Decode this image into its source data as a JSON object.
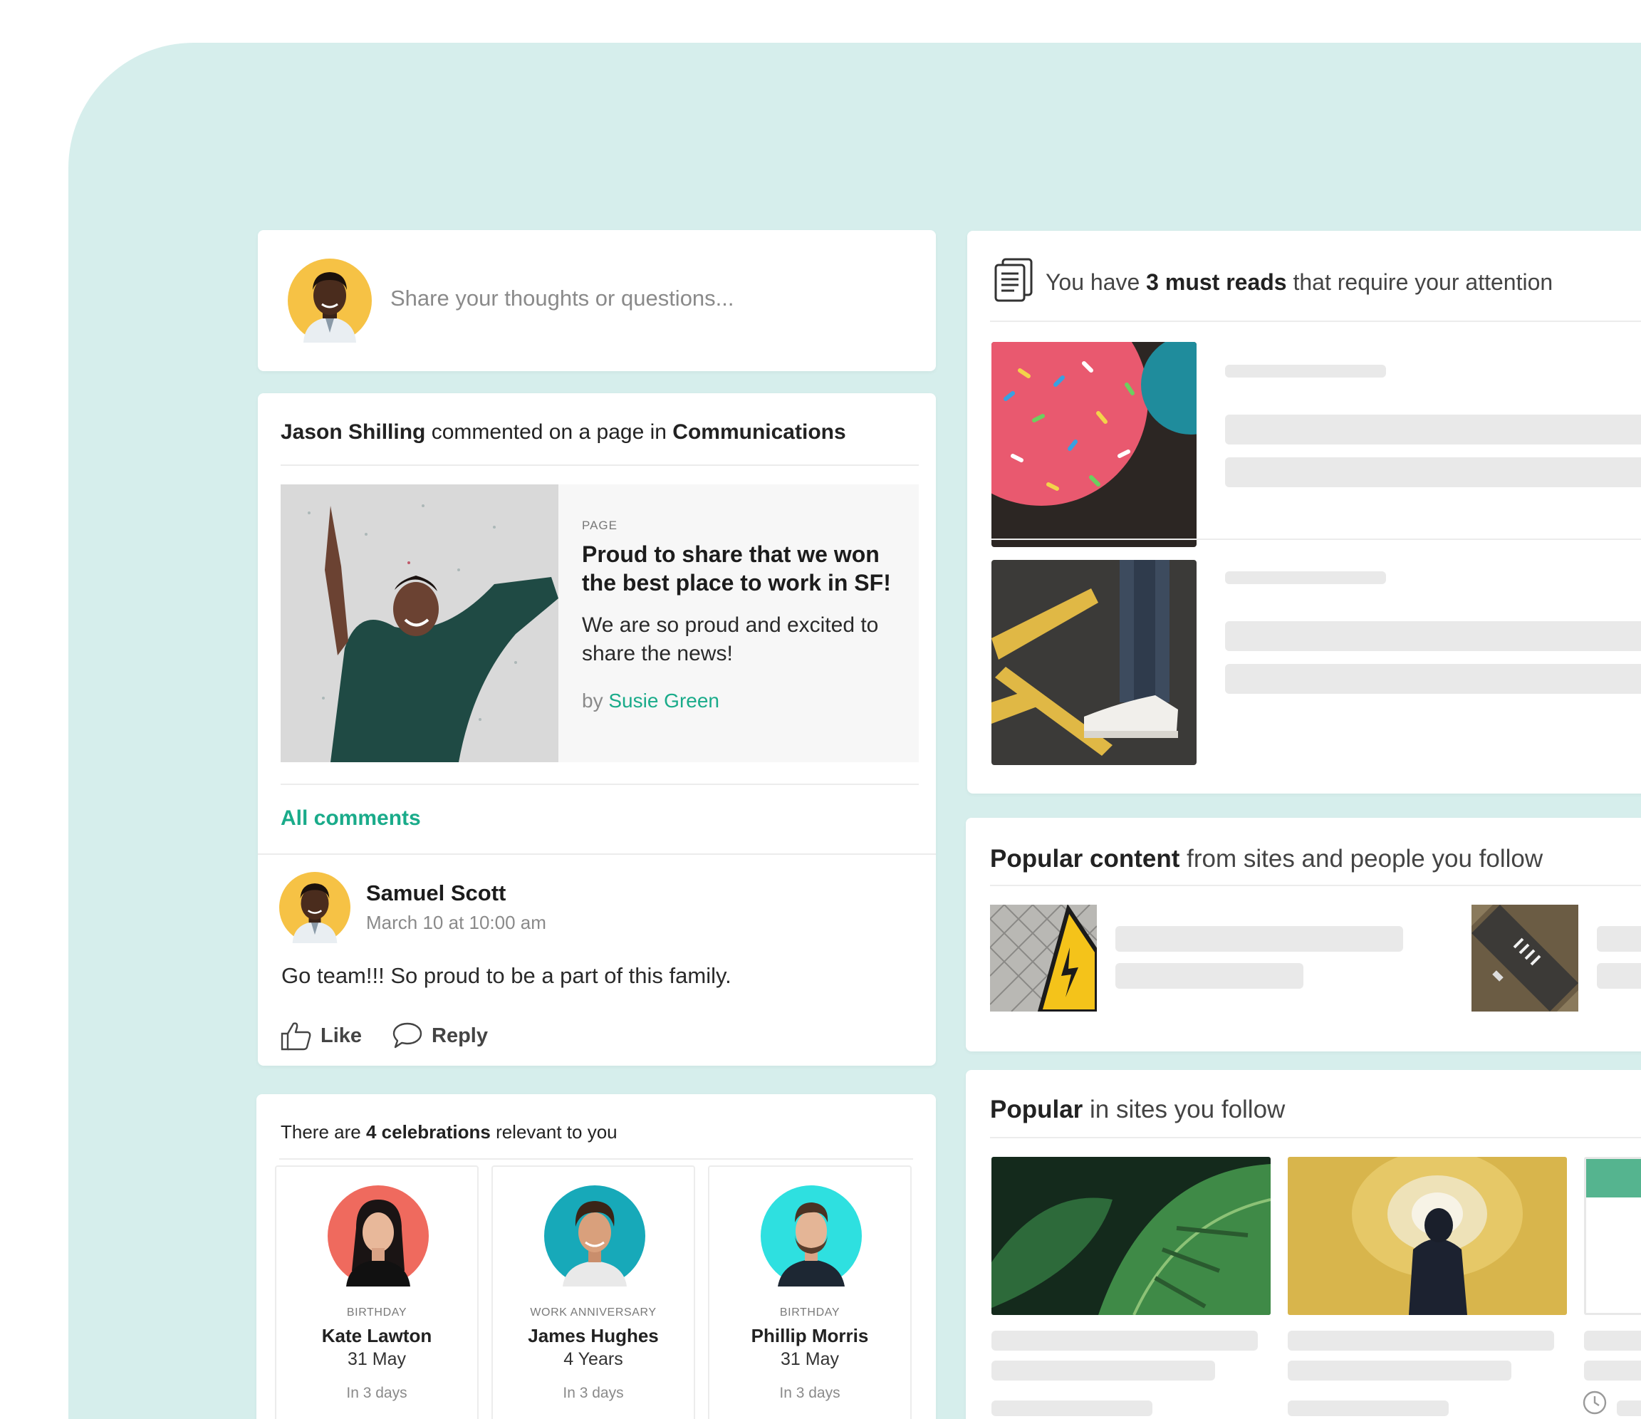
{
  "composer": {
    "placeholder": "Share your thoughts or questions..."
  },
  "activity": {
    "actor": "Jason Shilling",
    "action": "commented on a page in",
    "place": "Communications",
    "share": {
      "kind": "PAGE",
      "title": "Proud to share that we won the best place to work in SF!",
      "description": "We are so proud and excited to share the news!",
      "by_label": "by",
      "author": "Susie Green"
    },
    "all_comments_label": "All comments",
    "comment": {
      "author": "Samuel Scott",
      "time": "March 10 at 10:00 am",
      "text": "Go team!!! So proud to be a part of this family."
    },
    "actions": {
      "like": "Like",
      "reply": "Reply"
    }
  },
  "celebrations": {
    "prefix": "There are",
    "count_label": "4 celebrations",
    "suffix": "relevant to you",
    "items": [
      {
        "kind": "BIRTHDAY",
        "name": "Kate Lawton",
        "date": "31 May",
        "when": "In 3 days",
        "avatar_color": "#ef6a5e"
      },
      {
        "kind": "WORK ANNIVERSARY",
        "name": "James Hughes",
        "date": "4 Years",
        "when": "In 3 days",
        "avatar_color": "#17a9b9"
      },
      {
        "kind": "BIRTHDAY",
        "name": "Phillip Morris",
        "date": "31 May",
        "when": "In 3 days",
        "avatar_color": "#2ee0e0"
      }
    ]
  },
  "must_reads": {
    "prefix": "You have",
    "count_label": "3 must reads",
    "suffix": "that require your attention",
    "icon": "document-icon"
  },
  "popular_content": {
    "bold": "Popular content",
    "rest": "from sites and people you follow"
  },
  "popular_sites": {
    "bold": "Popular",
    "rest": "in sites you follow"
  },
  "colors": {
    "accent": "#1aab8a",
    "background": "#d6eeec",
    "avatar_yellow": "#f6c245"
  }
}
